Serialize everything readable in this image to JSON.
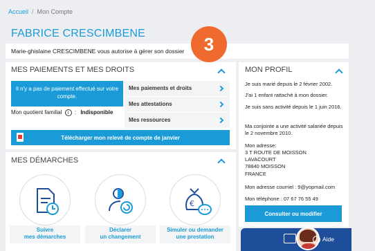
{
  "breadcrumb": {
    "home": "Accueil",
    "separator": "/",
    "current": "Mon Compte"
  },
  "user_name": "FABRICE CRESCIMBENE",
  "notice": "Marie-ghislaine CRESCIMBENE vous autorise à gérer son dossier",
  "step_badge": "3",
  "payments": {
    "title": "MES PAIEMENTS ET MES DROITS",
    "no_payment": "Il n'y a pas de paiement effectué sur votre compte.",
    "quotient_label": "Mon quotient familial",
    "quotient_sep": ":",
    "quotient_value": "Indisponible",
    "menu": [
      "Mes paiements et droits",
      "Mes attestations",
      "Mes ressources"
    ],
    "download": "Télécharger mon relevé de compte de janvier"
  },
  "demarches": {
    "title": "MES DÉMARCHES",
    "buttons": [
      {
        "line1": "Suivre",
        "line2": "mes démarches"
      },
      {
        "line1": "Déclarer",
        "line2": "un changement"
      },
      {
        "line1": "Simuler ou demander",
        "line2": "une prestation"
      }
    ]
  },
  "profile": {
    "title": "MON PROFIL",
    "lines": [
      "Je suis marié depuis le 2 février 2002.",
      "J'ai 1 enfant rattaché à mon dossier.",
      "Je suis sans activité depuis le 1 juin 2016.",
      "Ma conjointe a une activité salariée depuis le 2 novembre 2010."
    ],
    "address_label": "Mon adresse:",
    "address": [
      "3 T ROUTE DE MOISSON",
      "LAVACOURT",
      "78840 MOISSON",
      "FRANCE"
    ],
    "email": "Mon adresse courriel : 9@yopmail.com",
    "phone": "Mon téléphone : 07 67 76 55 49",
    "consult_button": "Consulter ou modifier"
  },
  "help": {
    "label": "Aide",
    "icon": "i"
  },
  "colors": {
    "accent": "#1a9bd7",
    "badge": "#ef6a2e",
    "help_bar": "#1e4e9a"
  }
}
